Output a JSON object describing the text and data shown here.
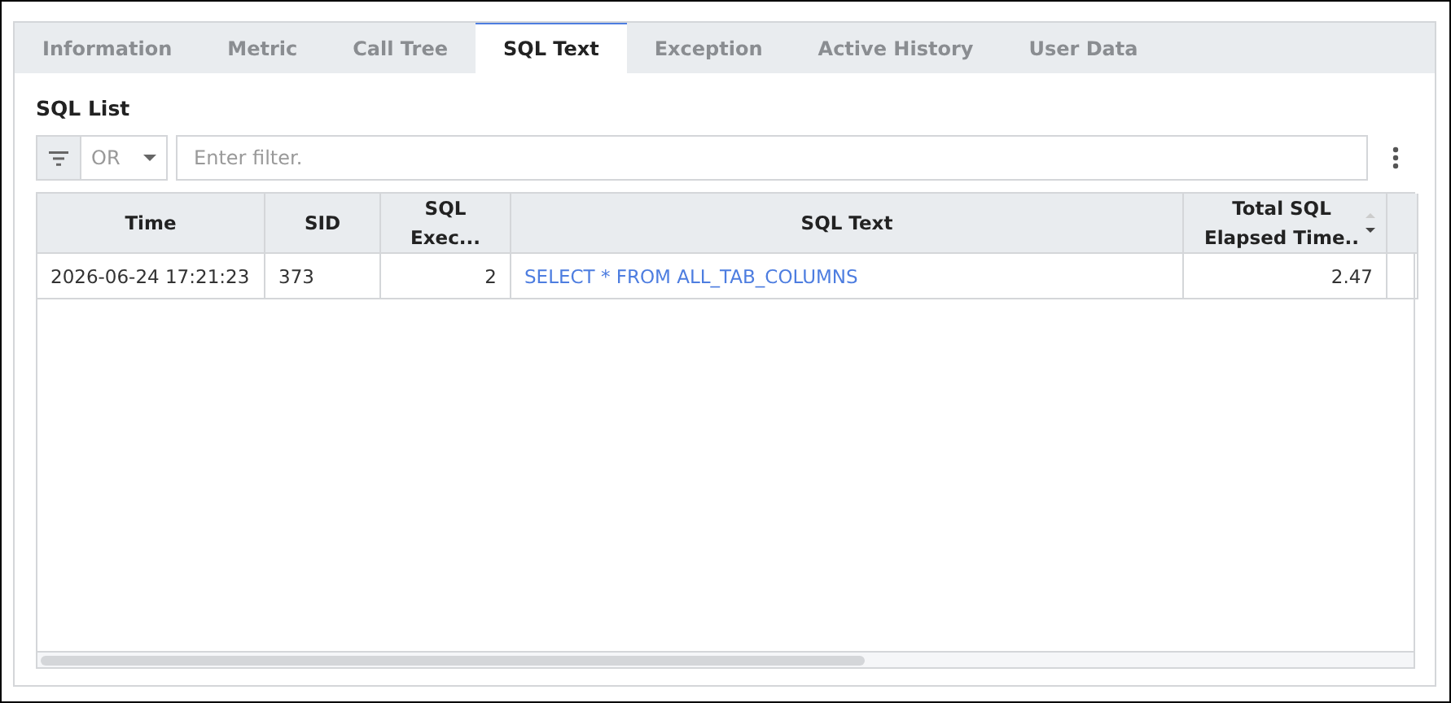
{
  "tabs": [
    {
      "label": "Information",
      "selected": false
    },
    {
      "label": "Metric",
      "selected": false
    },
    {
      "label": "Call Tree",
      "selected": false
    },
    {
      "label": "SQL Text",
      "selected": true
    },
    {
      "label": "Exception",
      "selected": false
    },
    {
      "label": "Active History",
      "selected": false
    },
    {
      "label": "User Data",
      "selected": false
    }
  ],
  "section_title": "SQL List",
  "filter": {
    "operator": "OR",
    "placeholder": "Enter filter."
  },
  "table": {
    "columns": [
      {
        "label": "Time",
        "sorted_descending": false
      },
      {
        "label": "SID",
        "sorted_descending": false
      },
      {
        "label": "SQL Exec...",
        "sorted_descending": false
      },
      {
        "label": "SQL Text",
        "sorted_descending": false
      },
      {
        "label": "Total SQL Elapsed Time..",
        "sorted_descending": true
      }
    ],
    "rows": [
      {
        "cells": [
          {
            "text": "2026-06-24 17:21:23",
            "kind": "text"
          },
          {
            "text": "373",
            "kind": "text"
          },
          {
            "text": "2",
            "kind": "number"
          },
          {
            "text": "SELECT * FROM ALL_TAB_COLUMNS",
            "kind": "link"
          },
          {
            "text": "2.47",
            "kind": "number"
          }
        ]
      }
    ]
  }
}
